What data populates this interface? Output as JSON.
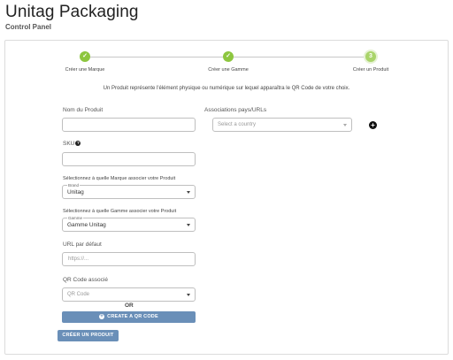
{
  "app": {
    "title": "Unitag Packaging",
    "subtitle": "Control Panel"
  },
  "stepper": {
    "steps": [
      {
        "label": "Créer une Marque",
        "status": "done",
        "icon": "check-icon",
        "glyph": "✓"
      },
      {
        "label": "Créer une Gamme",
        "status": "done",
        "icon": "check-icon",
        "glyph": "✓"
      },
      {
        "label": "Créer un Produit",
        "status": "current",
        "icon": "step-number",
        "glyph": "3"
      }
    ]
  },
  "intro": "Un Produit représente l'élément physique ou numérique sur lequel apparaîtra le QR Code de votre choix.",
  "form": {
    "product_name_label": "Nom du Produit",
    "product_name_value": "",
    "sku_label": "SKU",
    "sku_help_glyph": "?",
    "sku_value": "",
    "brand_question": "Sélectionnez à quelle Marque associer votre Produit",
    "brand_floating_label": "Brand",
    "brand_value": "Unitag",
    "range_question": "Sélectionnez à quelle Gamme associer votre Produit",
    "range_floating_label": "Gamme",
    "range_value": "Gamme Unitag",
    "default_url_label": "URL par défaut",
    "default_url_placeholder": "https://...",
    "qr_label": "QR Code associé",
    "qr_placeholder": "QR Code",
    "or_text": "OR",
    "create_qr_button": "CREATE A QR CODE",
    "create_qr_icon_glyph": "+",
    "associations_label": "Associations pays/URLs",
    "country_placeholder": "Select a country",
    "add_association_glyph": "+",
    "submit_button": "CRÉER UN PRODUIT"
  },
  "colors": {
    "step_done": "#8dc63f",
    "primary_button": "#6a8fb8"
  }
}
